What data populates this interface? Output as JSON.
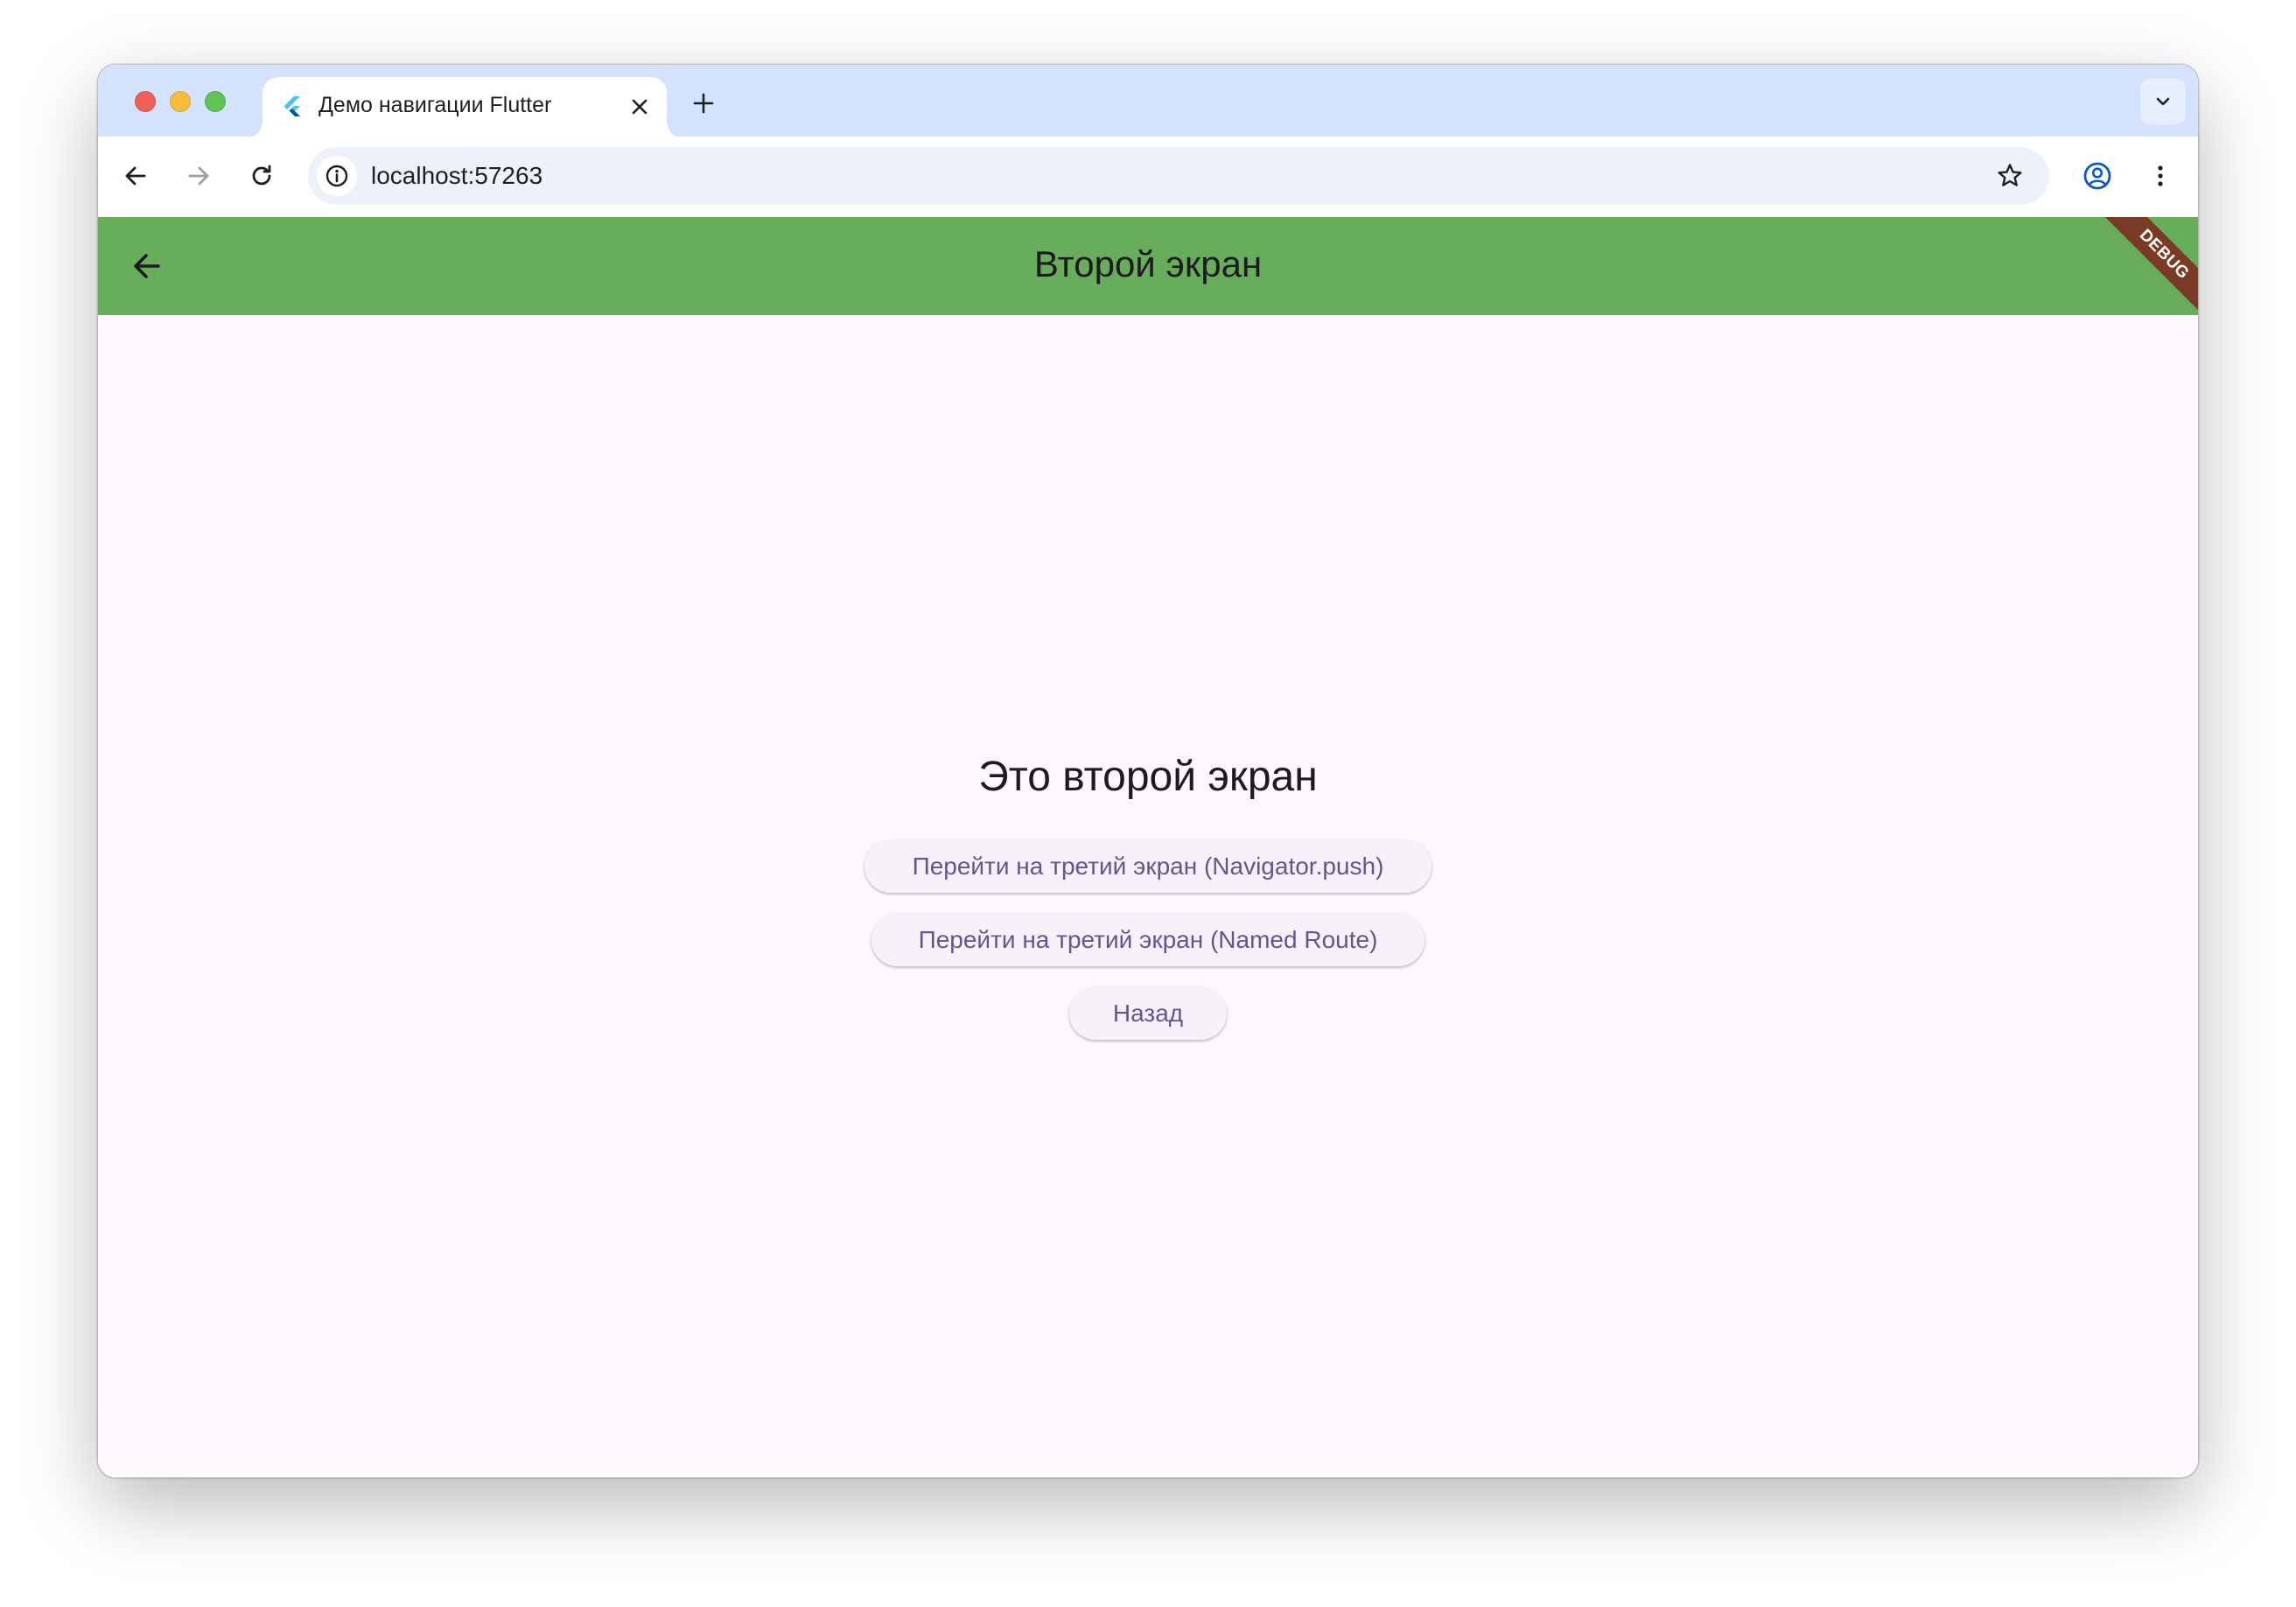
{
  "browser": {
    "tab": {
      "title": "Демо навигации Flutter",
      "favicon": "flutter-logo-icon"
    },
    "new_tab_icon": "plus-icon",
    "tab_search_icon": "chevron-down-icon",
    "address_bar": {
      "url": "localhost:57263",
      "site_info_icon": "info-icon",
      "bookmark_icon": "star-icon"
    },
    "nav": {
      "back_icon": "arrow-left-icon",
      "forward_icon": "arrow-right-icon",
      "reload_icon": "reload-icon",
      "profile_icon": "profile-icon",
      "menu_icon": "more-vertical-icon"
    }
  },
  "app": {
    "appbar": {
      "title": "Второй экран",
      "back_icon": "arrow-left-icon",
      "color": "#68ad5b"
    },
    "debug_banner": "DEBUG",
    "heading": "Это второй экран",
    "buttons": {
      "push": "Перейти на третий экран (Navigator.push)",
      "named": "Перейти на третий экран (Named Route)",
      "back": "Назад"
    }
  }
}
